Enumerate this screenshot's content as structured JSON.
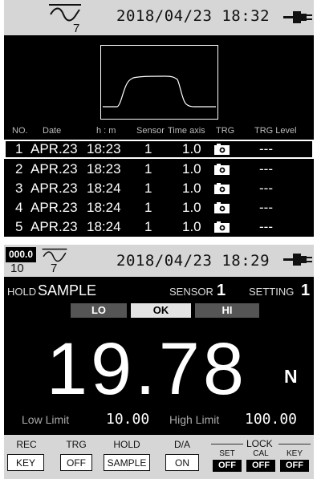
{
  "top_panel": {
    "header": {
      "channel_number": "7",
      "datetime": "2018/04/23  18:32"
    },
    "table_headers": [
      "NO.",
      "Date",
      "h : m",
      "Sensor",
      "Time axis",
      "TRG",
      "TRG Level"
    ],
    "rows": [
      {
        "no": "1",
        "date": "APR.23",
        "time": "18:23",
        "sensor": "1",
        "time_axis": "1.0",
        "trg": "camera",
        "trg_level": "---",
        "selected": true
      },
      {
        "no": "2",
        "date": "APR.23",
        "time": "18:23",
        "sensor": "1",
        "time_axis": "1.0",
        "trg": "camera",
        "trg_level": "---",
        "selected": false
      },
      {
        "no": "3",
        "date": "APR.23",
        "time": "18:24",
        "sensor": "1",
        "time_axis": "1.0",
        "trg": "camera",
        "trg_level": "---",
        "selected": false
      },
      {
        "no": "4",
        "date": "APR.23",
        "time": "18:24",
        "sensor": "1",
        "time_axis": "1.0",
        "trg": "camera",
        "trg_level": "---",
        "selected": false
      },
      {
        "no": "5",
        "date": "APR.23",
        "time": "18:24",
        "sensor": "1",
        "time_axis": "1.0",
        "trg": "camera",
        "trg_level": "---",
        "selected": false
      }
    ]
  },
  "bottom_panel": {
    "header": {
      "counter": "000.0",
      "counter_sub": "10",
      "channel_number": "7",
      "datetime": "2018/04/23  18:29"
    },
    "hold_label": "HOLD",
    "hold_value": "SAMPLE",
    "sensor_label": "SENSOR",
    "sensor_value": "1",
    "setting_label": "SETTING",
    "setting_value": "1",
    "judgement": {
      "lo": "LO",
      "ok": "OK",
      "hi": "HI",
      "active": "ok"
    },
    "value": "19.78",
    "unit": "N",
    "low_limit_label": "Low Limit",
    "low_limit": "10.00",
    "high_limit_label": "High Limit",
    "high_limit": "100.00",
    "function_keys": [
      {
        "label": "REC",
        "button": "KEY"
      },
      {
        "label": "TRG",
        "button": "OFF"
      },
      {
        "label": "HOLD",
        "button": "SAMPLE"
      },
      {
        "label": "D/A",
        "button": "ON"
      }
    ],
    "lock": {
      "title": "LOCK",
      "items": [
        {
          "name": "SET",
          "state": "OFF"
        },
        {
          "name": "CAL",
          "state": "OFF"
        },
        {
          "name": "KEY",
          "state": "OFF"
        }
      ]
    }
  },
  "colors": {
    "panel_bg": "#000000",
    "header_bg": "#d6d6d6",
    "text": "#ffffff",
    "judge_ok": "#e4e4e4",
    "judge_inactive": "#555555"
  },
  "icons": {
    "wave": "waveform-icon",
    "power": "ac-plug-icon",
    "trigger": "camera-icon"
  }
}
